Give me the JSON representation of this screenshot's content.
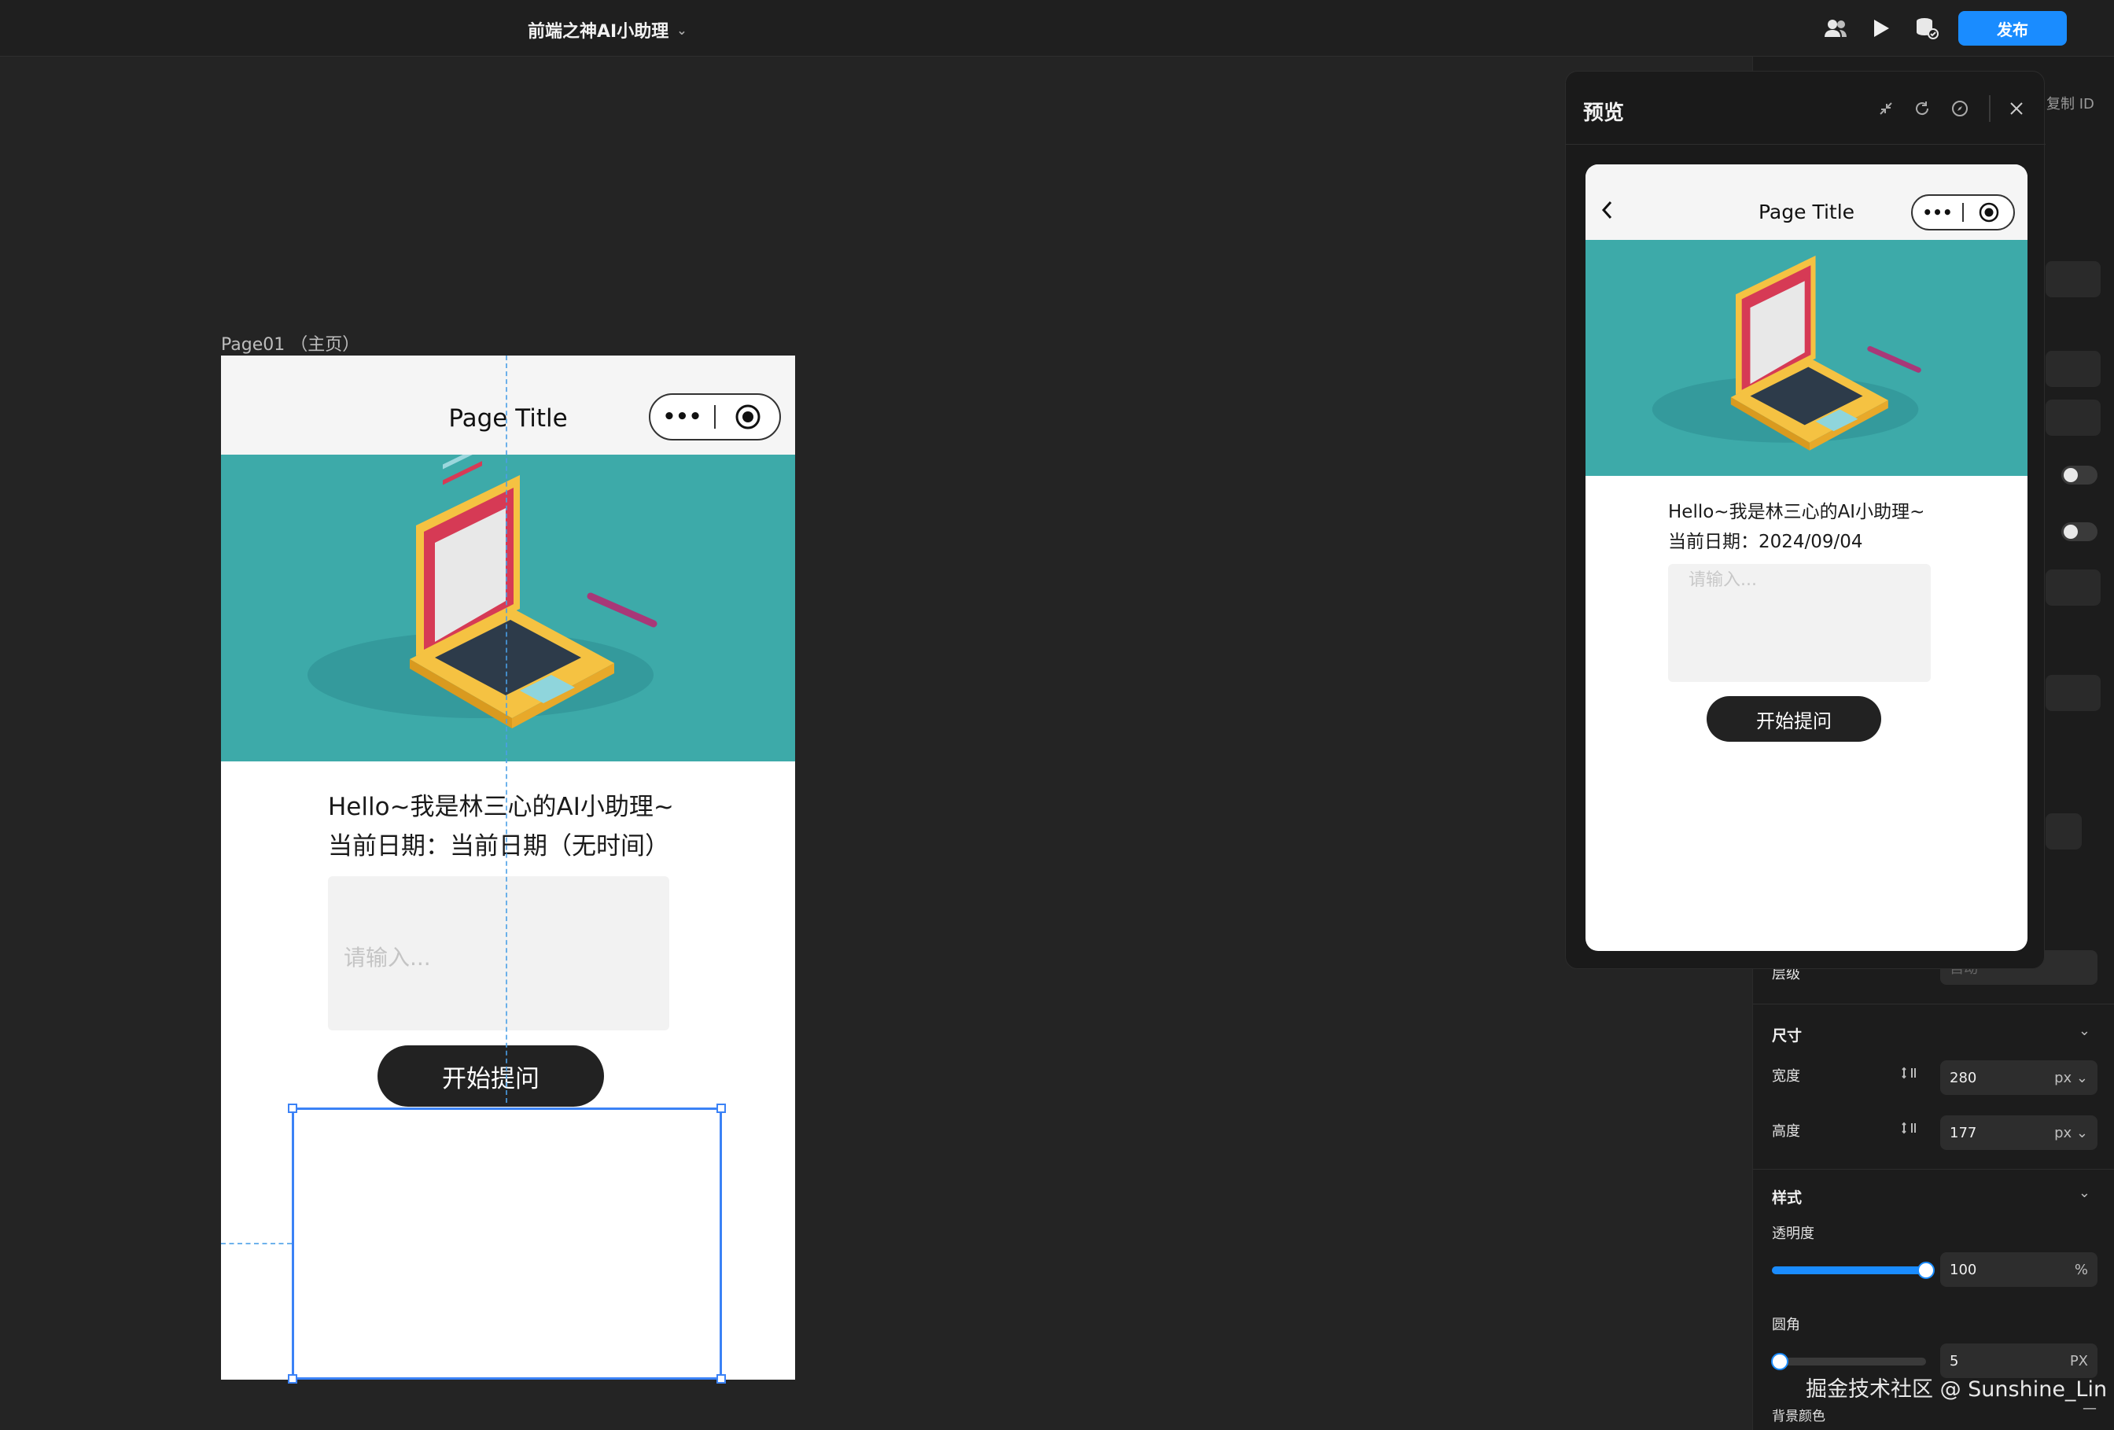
{
  "topbar": {
    "app_title": "前端之神AI小助理",
    "publish_label": "发布",
    "icons": [
      "users-icon",
      "play-icon",
      "database-icon"
    ]
  },
  "canvas": {
    "page_label": "Page01 （主页）",
    "nav_title": "Page Title",
    "greeting": "Hello~我是林三心的AI小助理~",
    "date_line": "当前日期：当前日期（无时间）",
    "input_placeholder": "请输入...",
    "button_label": "开始提问"
  },
  "preview": {
    "title": "预览",
    "copy_id_label": "复制 ID",
    "nav_title": "Page Title",
    "greeting": "Hello~我是林三心的AI小助理~",
    "date_line": "当前日期：2024/09/04",
    "input_placeholder": "请输入...",
    "button_label": "开始提问"
  },
  "properties": {
    "layer_label": "层级",
    "layer_value": "自动",
    "size_section": "尺寸",
    "width_label": "宽度",
    "width_value": "280",
    "width_unit": "px",
    "height_label": "高度",
    "height_value": "177",
    "height_unit": "px",
    "style_section": "样式",
    "opacity_label": "透明度",
    "opacity_value": "100",
    "opacity_unit": "%",
    "opacity_level": 1.0,
    "radius_label": "圆角",
    "radius_value": "5",
    "radius_unit": "PX",
    "radius_level": 0.05,
    "bg_color_label": "背景颜色",
    "bg_color_value": "—"
  },
  "watermark": "掘金技术社区 @ Sunshine_Lin",
  "colors": {
    "accent": "#1a8cff",
    "hero_teal": "#3daaa9",
    "selection": "#3b82f6"
  }
}
